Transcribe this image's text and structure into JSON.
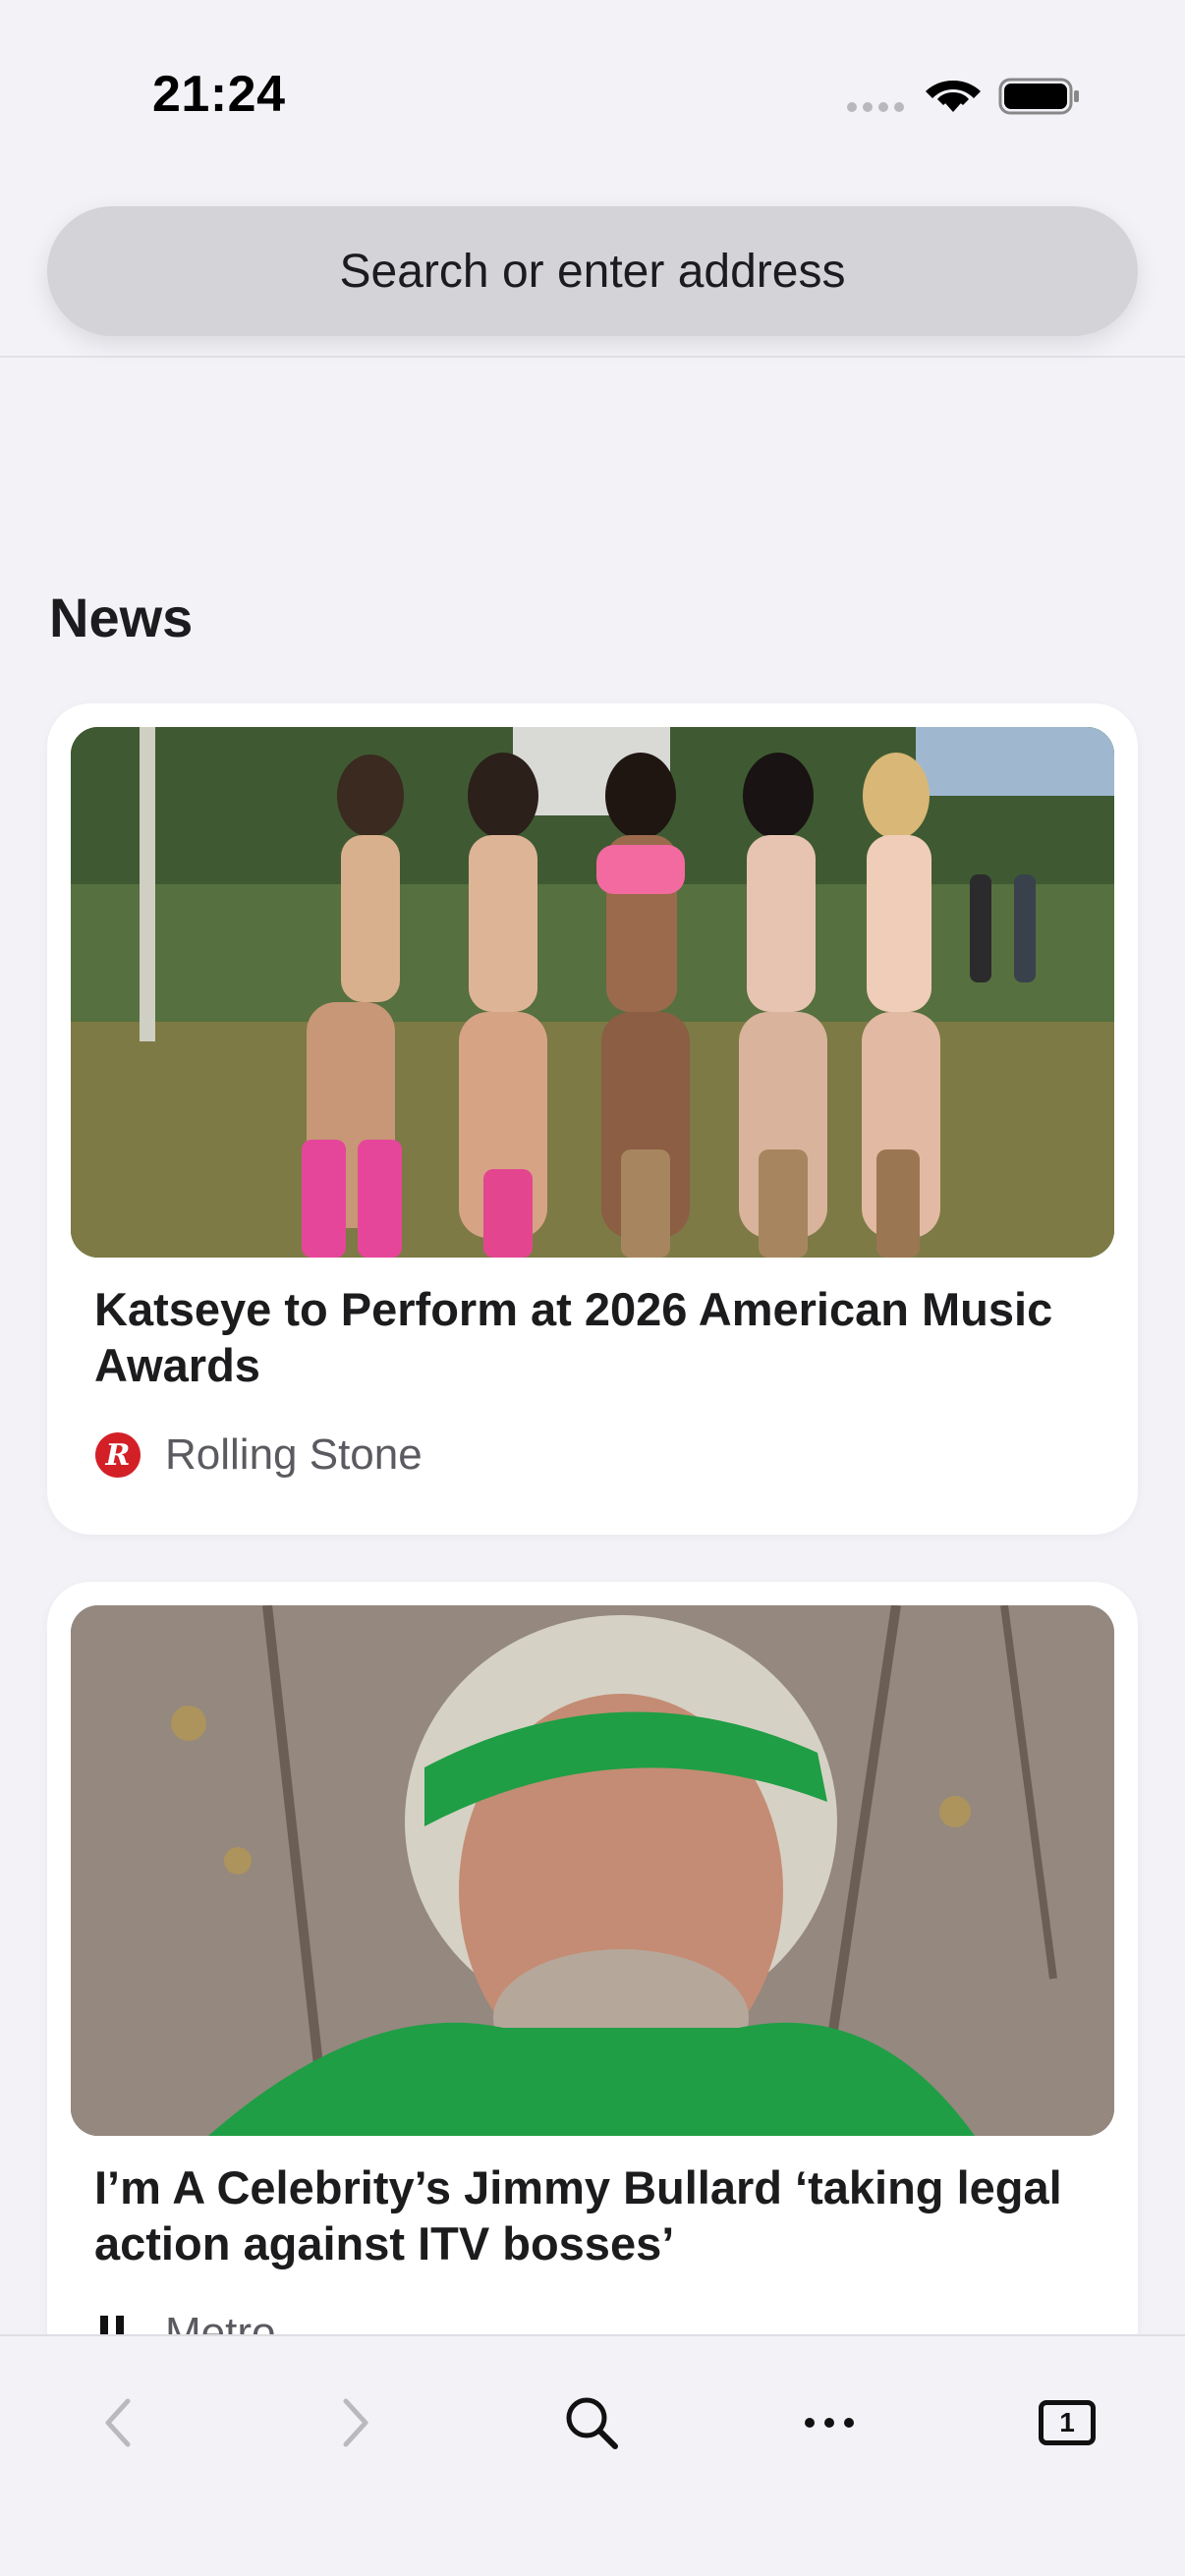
{
  "status_bar": {
    "time": "21:24"
  },
  "address_bar": {
    "placeholder": "Search or enter address"
  },
  "news": {
    "section_title": "News",
    "articles": [
      {
        "title": "Katseye to Perform at 2026 American Music Awards",
        "source": "Rolling Stone",
        "source_icon": "rolling-stone-logo",
        "image_description_icon": "news-photo"
      },
      {
        "title": "I’m A Celebrity’s Jimmy Bullard ‘taking legal action against ITV bosses’",
        "source": "Metro",
        "source_icon": "metro-logo",
        "image_description_icon": "news-photo"
      }
    ]
  },
  "toolbar": {
    "back_icon": "chevron-left-icon",
    "forward_icon": "chevron-right-icon",
    "search_icon": "search-icon",
    "more_icon": "ellipsis-icon",
    "tab_count": "1"
  },
  "colors": {
    "background": "#f2f2f7",
    "card": "#ffffff",
    "address_bar": "#d3d3d8",
    "rolling_stone_red": "#d32027"
  }
}
